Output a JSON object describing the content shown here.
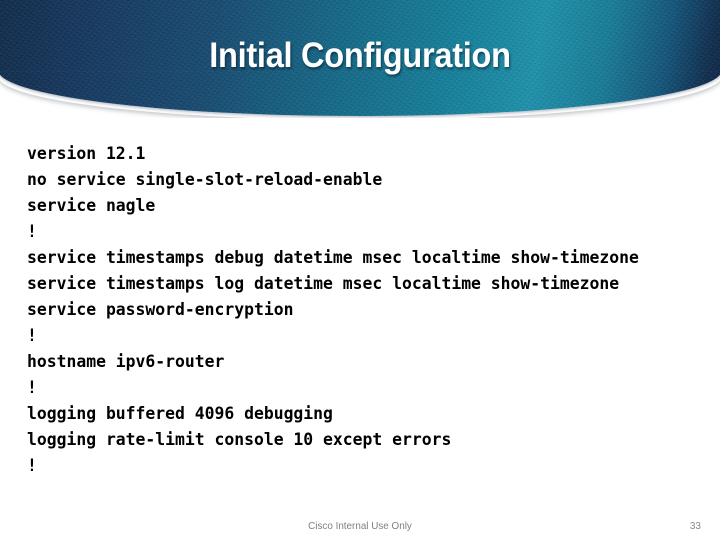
{
  "slide": {
    "title": "Initial Configuration",
    "banner": {
      "gradient_start": "#0d2747",
      "gradient_mid": "#1b90ab",
      "gradient_end": "#0a2142",
      "title_color": "#ffffff"
    },
    "config_lines": [
      "version 12.1",
      "no service single-slot-reload-enable",
      "service nagle",
      "!",
      "service timestamps debug datetime msec localtime show-timezone",
      "service timestamps log datetime msec localtime show-timezone",
      "service password-encryption",
      "!",
      "hostname ipv6-router",
      "!",
      "logging buffered 4096 debugging",
      "logging rate-limit console 10 except errors",
      "!"
    ],
    "footer": {
      "note": "Cisco Internal Use Only",
      "note_color": "#808080",
      "page_number": "33"
    }
  }
}
